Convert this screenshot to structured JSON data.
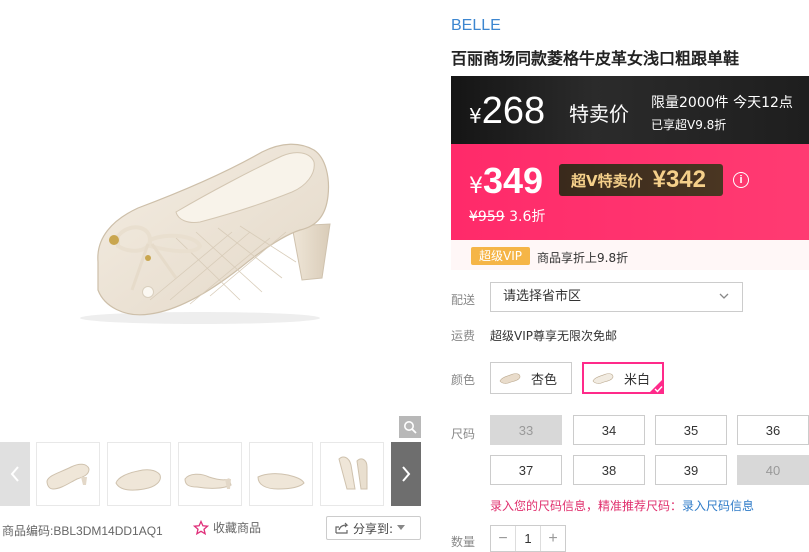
{
  "product": {
    "brand": "BELLE",
    "title": "百丽商场同款菱格牛皮革女浅口粗跟单鞋"
  },
  "gallery": {
    "thumb_count": 5,
    "sku_label": "商品编码:",
    "sku_value": "BBL3DM14DD1AQ1",
    "favorite_label": "收藏商品",
    "share_label": "分享到:"
  },
  "flash_sale": {
    "currency": "¥",
    "price": "268",
    "tag": "特卖价",
    "limit_text": "限量2000件 今天12点",
    "sub_text": "已享超V9.8折"
  },
  "promo": {
    "currency": "¥",
    "price": "349",
    "svip_label": "超V特卖价",
    "svip_price": "¥342",
    "info_icon": "i",
    "original_price": "¥959",
    "discount": "3.6折"
  },
  "vip": {
    "tag": "超级VIP",
    "text": "商品享折上9.8折"
  },
  "delivery": {
    "label": "配送",
    "placeholder": "请选择省市区"
  },
  "shipping": {
    "label": "运费",
    "text": "超级VIP尊享无限次免邮"
  },
  "color": {
    "label": "颜色",
    "options": [
      {
        "name": "杏色",
        "selected": false
      },
      {
        "name": "米白",
        "selected": true
      }
    ]
  },
  "size": {
    "label": "尺码",
    "options": [
      {
        "value": "33",
        "available": false
      },
      {
        "value": "34",
        "available": true
      },
      {
        "value": "35",
        "available": true
      },
      {
        "value": "36",
        "available": true
      },
      {
        "value": "37",
        "available": true
      },
      {
        "value": "38",
        "available": true
      },
      {
        "value": "39",
        "available": true
      },
      {
        "value": "40",
        "available": false
      }
    ],
    "hint_red": "录入您的尺码信息，精准推荐尺码：",
    "hint_link": "录入尺码信息"
  },
  "quantity": {
    "label": "数量",
    "value": "1",
    "minus": "−",
    "plus": "+"
  },
  "colors": {
    "brand_blue": "#3c86d0",
    "promo_pink": "#ff2a6a",
    "flash_black": "#1e1e1e",
    "svip_gold": "#f5d08a",
    "vip_orange": "#f5b547",
    "selected_border": "#ff2a8a"
  }
}
